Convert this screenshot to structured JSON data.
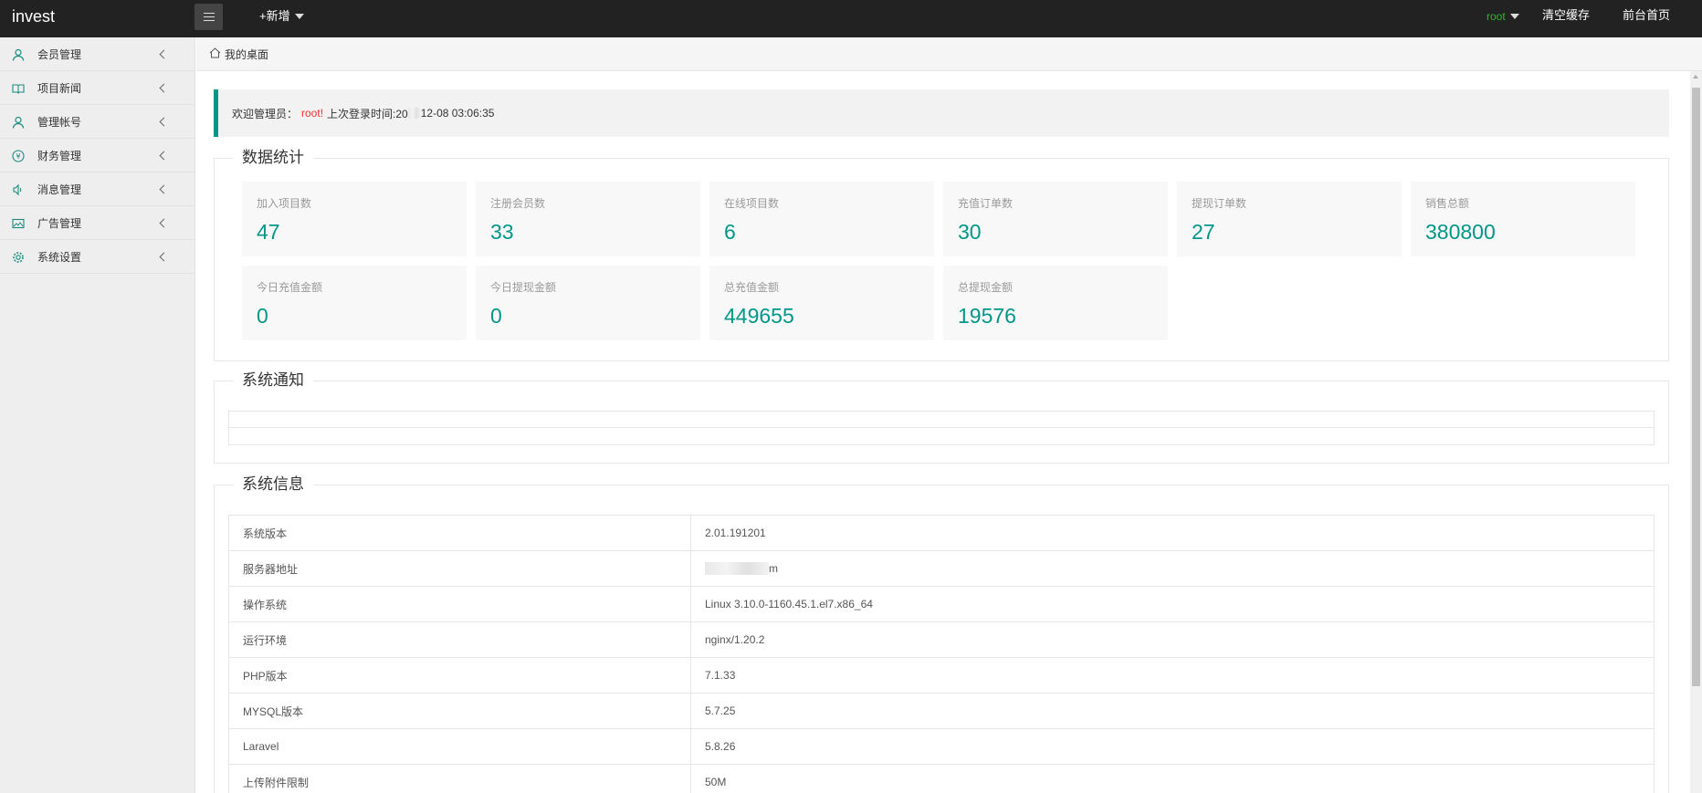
{
  "app": {
    "logo": "invest"
  },
  "topbar": {
    "add_new": "+新增",
    "user": "root",
    "clear_cache": "清空缓存",
    "front_home": "前台首页"
  },
  "sidebar": {
    "items": [
      {
        "label": "会员管理",
        "icon": "user-icon"
      },
      {
        "label": "项目新闻",
        "icon": "book-icon"
      },
      {
        "label": "管理帐号",
        "icon": "admin-icon"
      },
      {
        "label": "财务管理",
        "icon": "yen-icon"
      },
      {
        "label": "消息管理",
        "icon": "speaker-icon"
      },
      {
        "label": "广告管理",
        "icon": "image-icon"
      },
      {
        "label": "系统设置",
        "icon": "gear-icon"
      }
    ]
  },
  "breadcrumb": {
    "label": "我的桌面",
    "icon": "home-icon"
  },
  "welcome": {
    "prefix": "欢迎管理员：",
    "name": "root!",
    "login_label": "上次登录时间:20",
    "login_time": "12-08 03:06:35"
  },
  "stats": {
    "legend": "数据统计",
    "cards": [
      {
        "title": "加入项目数",
        "value": "47"
      },
      {
        "title": "注册会员数",
        "value": "33"
      },
      {
        "title": "在线项目数",
        "value": "6"
      },
      {
        "title": "充值订单数",
        "value": "30"
      },
      {
        "title": "提现订单数",
        "value": "27"
      },
      {
        "title": "销售总额",
        "value": "380800"
      },
      {
        "title": "今日充值金额",
        "value": "0"
      },
      {
        "title": "今日提现金额",
        "value": "0"
      },
      {
        "title": "总充值金额",
        "value": "449655"
      },
      {
        "title": "总提现金额",
        "value": "19576"
      }
    ]
  },
  "notice": {
    "legend": "系统通知"
  },
  "sysinfo": {
    "legend": "系统信息",
    "rows": [
      {
        "key": "系统版本",
        "value": "2.01.191201"
      },
      {
        "key": "服务器地址",
        "value": "m"
      },
      {
        "key": "操作系统",
        "value": "Linux 3.10.0-1160.45.1.el7.x86_64"
      },
      {
        "key": "运行环境",
        "value": "nginx/1.20.2"
      },
      {
        "key": "PHP版本",
        "value": "7.1.33"
      },
      {
        "key": "MYSQL版本",
        "value": "5.7.25"
      },
      {
        "key": "Laravel",
        "value": "5.8.26"
      },
      {
        "key": "上传附件限制",
        "value": "50M"
      }
    ]
  },
  "colors": {
    "accent": "#009688",
    "topbar": "#222222",
    "user": "#2eb82e",
    "name": "#ee3333"
  }
}
